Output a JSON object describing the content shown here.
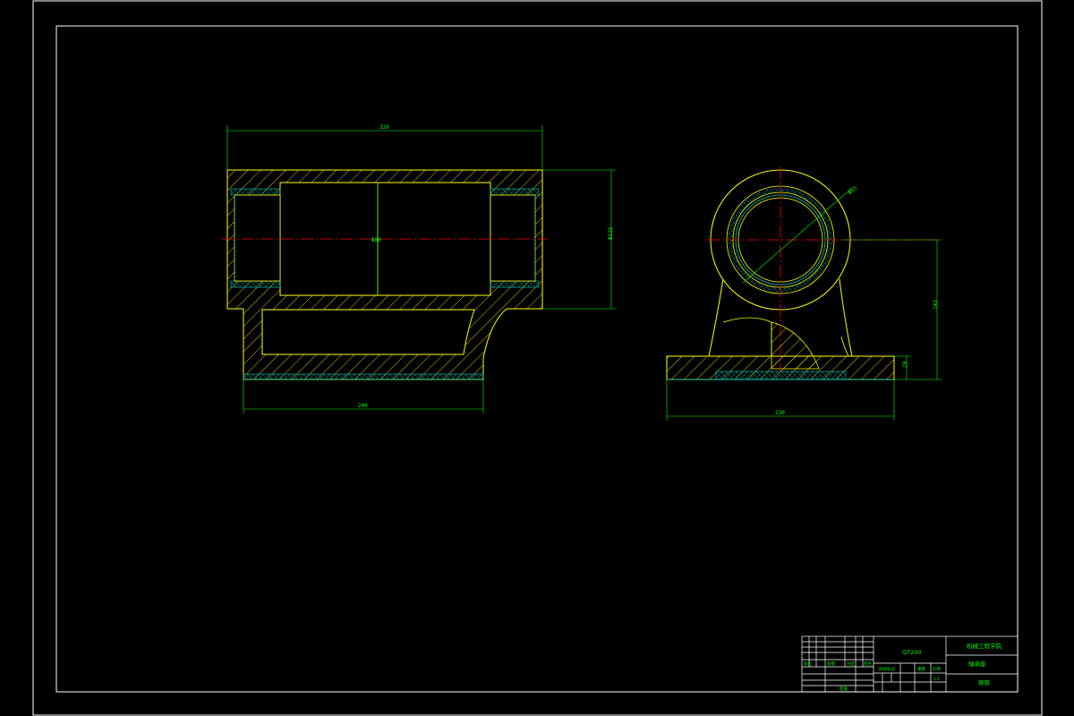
{
  "drawing": {
    "colors": {
      "background": "#000000",
      "border": "#ffffff",
      "outline": "#ffff00",
      "dimension": "#00ff00",
      "centerline": "#ff0000",
      "bushing": "#00c8c8"
    },
    "dimensions": {
      "top_width": "320",
      "bore": "Φ80",
      "height": "Φ125",
      "base_length": "240",
      "ring_diameter": "Φ55",
      "center_height": "143",
      "base_thickness": "20",
      "base_width": "230"
    },
    "title_block": {
      "drawing_no": "QT200",
      "school": "机械工程学院",
      "part_name": "轴承座",
      "material": "铸铁",
      "scale": "1:1",
      "row_labels": [
        "标记",
        "处数",
        "分区",
        "签名"
      ],
      "stage_labels": [
        "阶段标记",
        "重量",
        "比例"
      ],
      "approve_label": "批准"
    }
  }
}
